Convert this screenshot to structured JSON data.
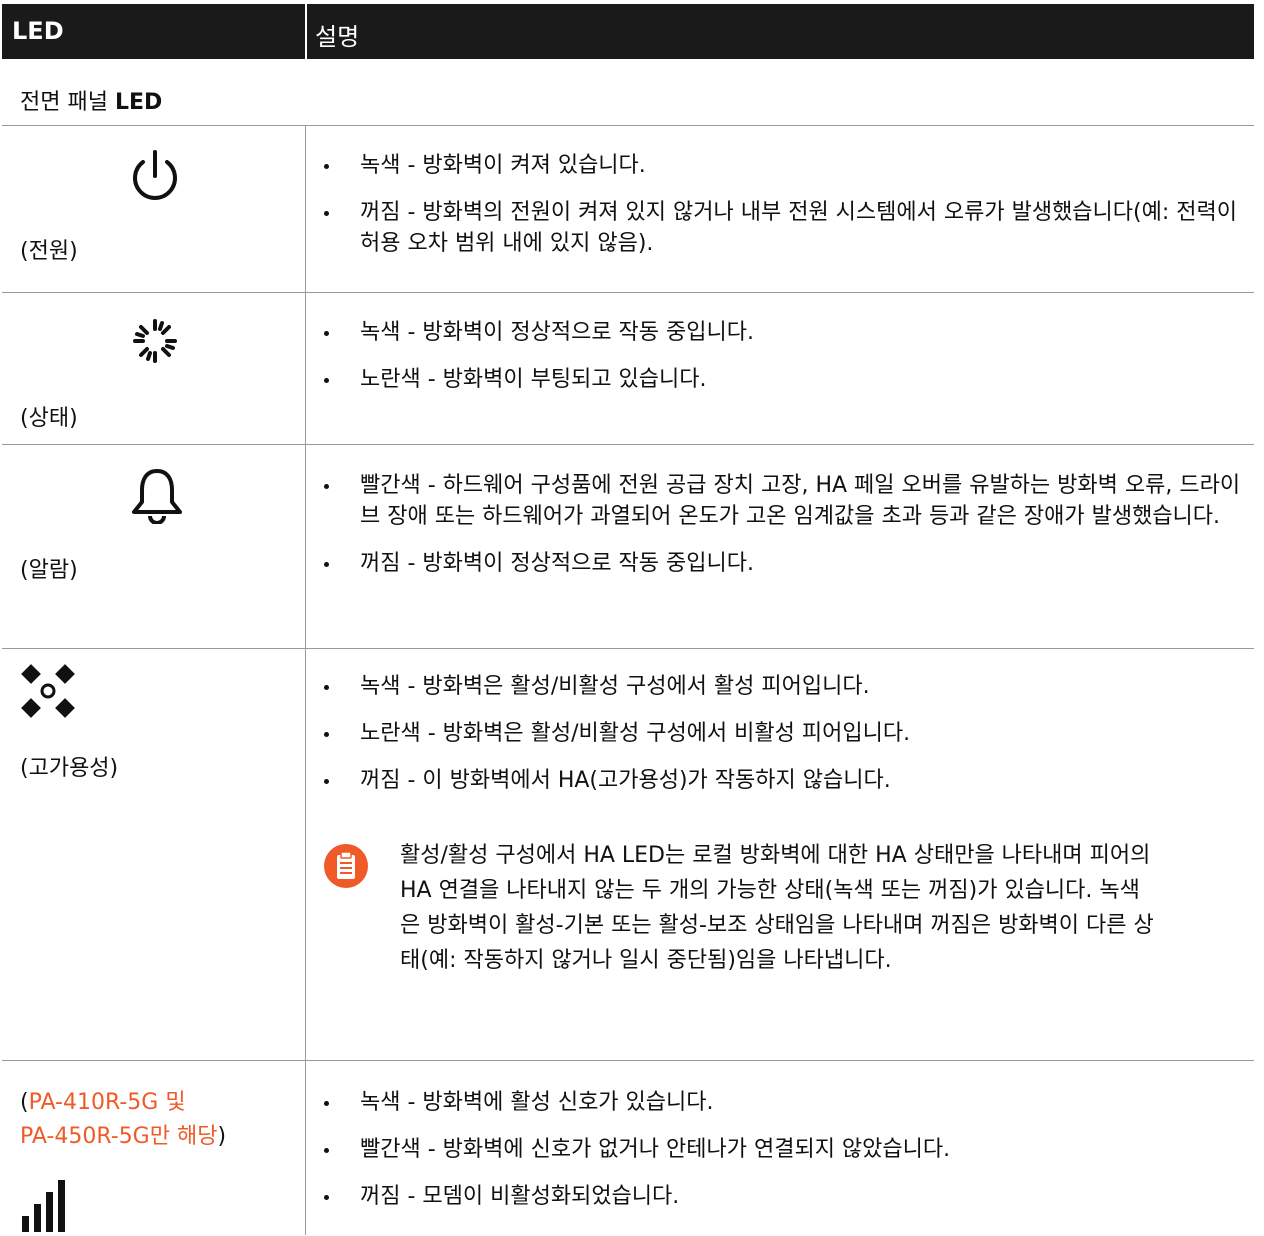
{
  "header": {
    "col1": "LED",
    "col2": "설명"
  },
  "section": {
    "prefix": "전면 패널 ",
    "bold": "LED"
  },
  "rows": [
    {
      "label": "(전원)",
      "icon": "power-icon",
      "items": [
        "녹색 - 방화벽이 켜져 있습니다.",
        "꺼짐 - 방화벽의 전원이 켜져 있지 않거나 내부 전원 시스템에서 오류가 발생했습니다(예: 전력이 허용 오차 범위 내에 있지 않음)."
      ]
    },
    {
      "label": "(상태)",
      "icon": "status-sparkle-icon",
      "items": [
        "녹색 - 방화벽이 정상적으로 작동 중입니다.",
        "노란색 - 방화벽이 부팅되고 있습니다."
      ]
    },
    {
      "label": "(알람)",
      "icon": "bell-icon",
      "items": [
        "빨간색 - 하드웨어 구성품에 전원 공급 장치 고장, HA 페일 오버를 유발하는 방화벽 오류, 드라이브 장애 또는 하드웨어가 과열되어 온도가 고온 임계값을 초과 등과 같은 장애가 발생했습니다.",
        "꺼짐 - 방화벽이 정상적으로 작동 중입니다."
      ]
    },
    {
      "label": "(고가용성)",
      "icon": "ha-diamonds-icon",
      "items": [
        "녹색 - 방화벽은 활성/비활성 구성에서 활성 피어입니다.",
        "노란색 - 방화벽은 활성/비활성 구성에서 비활성 피어입니다.",
        "꺼짐 - 이 방화벽에서 HA(고가용성)가 작동하지 않습니다."
      ],
      "note": "활성/활성 구성에서 HA LED는 로컬 방화벽에 대한 HA 상태만을 나타내며 피어의 HA 연결을 나타내지 않는 두 개의 가능한 상태(녹색 또는 꺼짐)가 있습니다. 녹색은 방화벽이 활성-기본 또는 활성-보조 상태임을 나타내며 꺼짐은 방화벽이 다른 상태(예: 작동하지 않거나 일시 중단됨)임을 나타냅니다."
    },
    {
      "label_open": "(",
      "label_model1": "PA-410R-5G",
      "label_and": " 및",
      "label_model2": "PA-450R-5G",
      "label_only": "만 해당",
      "label_close": ")",
      "icon": "signal-bars-icon",
      "items": [
        "녹색 - 방화벽에 활성 신호가 있습니다.",
        "빨간색 - 방화벽에 신호가 없거나 안테나가 연결되지 않았습니다.",
        "꺼짐 - 모뎀이 비활성화되었습니다."
      ]
    }
  ],
  "colors": {
    "header_bg": "#1a1a1a",
    "accent": "#f05a28"
  }
}
